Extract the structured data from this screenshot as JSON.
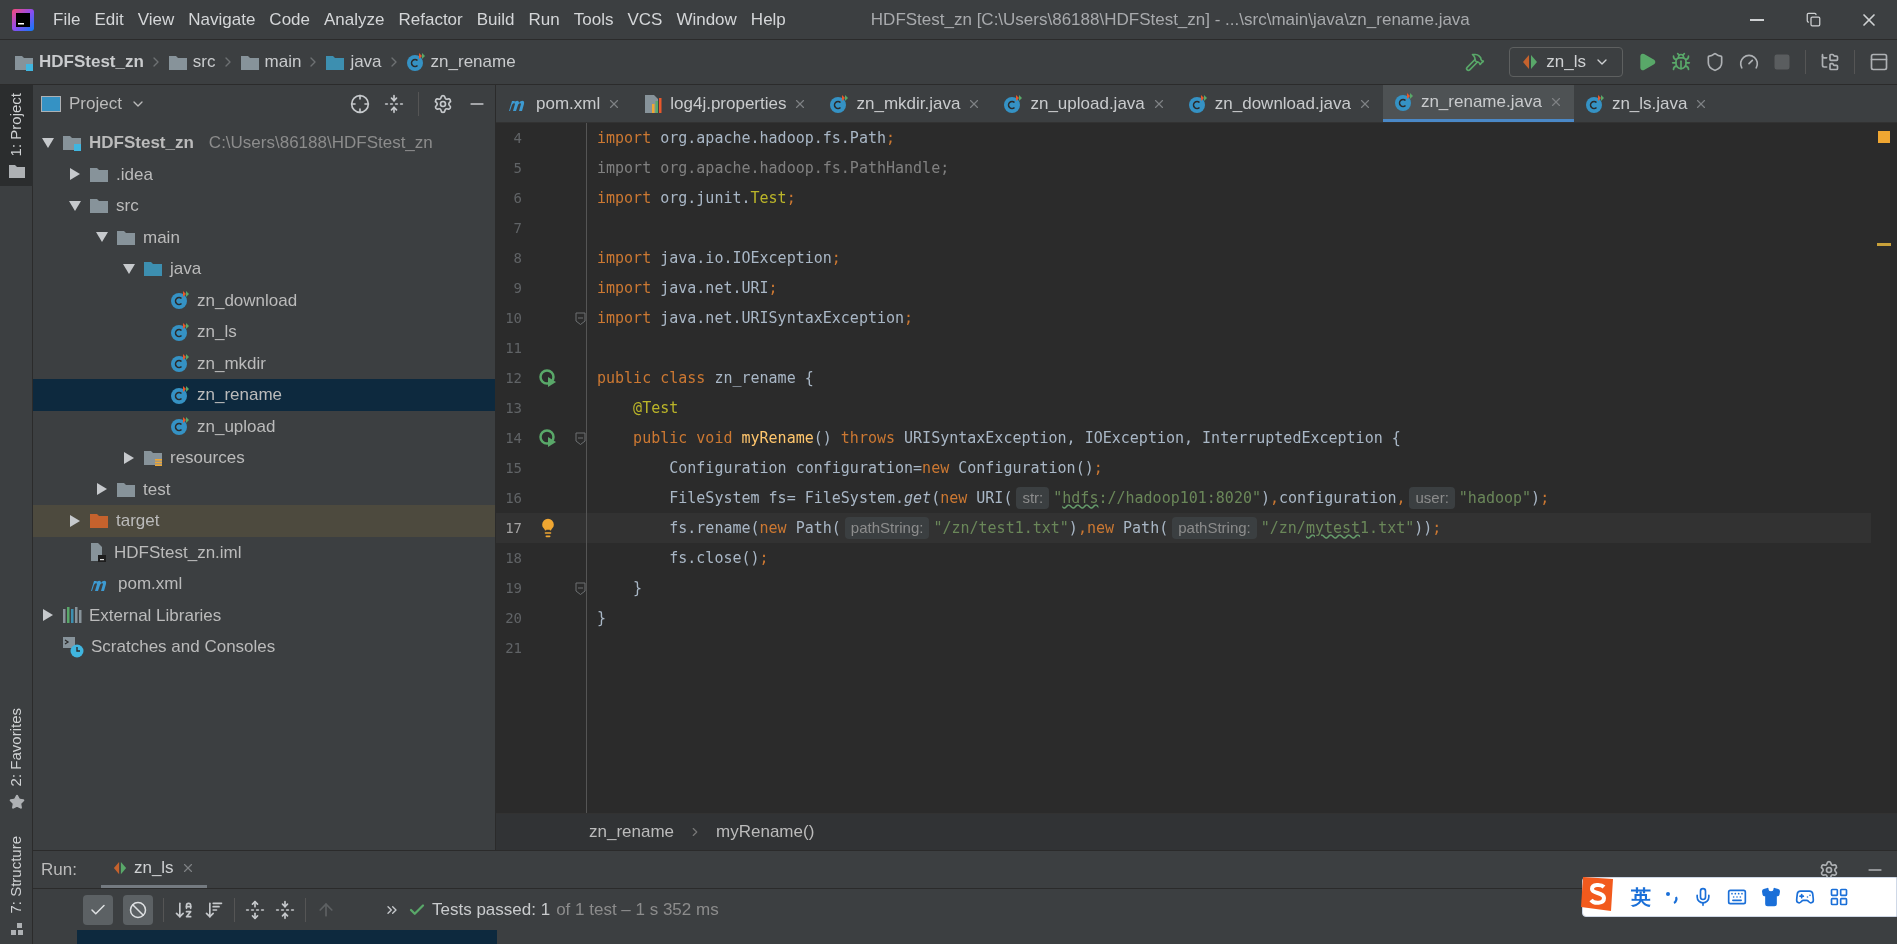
{
  "menu": [
    "File",
    "Edit",
    "View",
    "Navigate",
    "Code",
    "Analyze",
    "Refactor",
    "Build",
    "Run",
    "Tools",
    "VCS",
    "Window",
    "Help"
  ],
  "window_title": "HDFStest_zn [C:\\Users\\86188\\HDFStest_zn] - ...\\src\\main\\java\\zn_rename.java",
  "breadcrumb": [
    {
      "label": "HDFStest_zn",
      "kind": "project"
    },
    {
      "label": "src",
      "kind": "folder"
    },
    {
      "label": "main",
      "kind": "folder"
    },
    {
      "label": "java",
      "kind": "source"
    },
    {
      "label": "zn_rename",
      "kind": "class"
    }
  ],
  "run_config": "zn_ls",
  "tool_stripe": [
    {
      "label": "1: Project",
      "selected": true
    },
    {
      "label": "2: Favorites",
      "selected": false
    },
    {
      "label": "7: Structure",
      "selected": false
    }
  ],
  "project_panel": {
    "title": "Project"
  },
  "tree": [
    {
      "label": "HDFStest_zn",
      "path": "C:\\Users\\86188\\HDFStest_zn",
      "kind": "project",
      "expanded": true,
      "selected": false,
      "children": [
        {
          "label": ".idea",
          "kind": "folder",
          "expanded": false,
          "selected": false
        },
        {
          "label": "src",
          "kind": "folder",
          "expanded": true,
          "selected": false,
          "children": [
            {
              "label": "main",
              "kind": "folder",
              "expanded": true,
              "selected": false,
              "children": [
                {
                  "label": "java",
                  "kind": "source",
                  "expanded": true,
                  "selected": false,
                  "children": [
                    {
                      "label": "zn_download",
                      "kind": "class",
                      "selected": false
                    },
                    {
                      "label": "zn_ls",
                      "kind": "class",
                      "selected": false
                    },
                    {
                      "label": "zn_mkdir",
                      "kind": "class",
                      "selected": false
                    },
                    {
                      "label": "zn_rename",
                      "kind": "class",
                      "selected": true
                    },
                    {
                      "label": "zn_upload",
                      "kind": "class",
                      "selected": false
                    }
                  ]
                },
                {
                  "label": "resources",
                  "kind": "resources",
                  "expanded": false,
                  "selected": false
                }
              ]
            },
            {
              "label": "test",
              "kind": "folder",
              "expanded": false,
              "selected": false
            }
          ]
        },
        {
          "label": "target",
          "kind": "excluded",
          "expanded": false,
          "selected": false
        },
        {
          "label": "HDFStest_zn.iml",
          "kind": "iml",
          "selected": false
        },
        {
          "label": "pom.xml",
          "kind": "maven",
          "selected": false
        }
      ]
    },
    {
      "label": "External Libraries",
      "kind": "libraries",
      "expanded": false,
      "selected": false
    },
    {
      "label": "Scratches and Consoles",
      "kind": "scratches",
      "selected": false
    }
  ],
  "tabs": [
    {
      "label": "pom.xml",
      "kind": "maven",
      "selected": false
    },
    {
      "label": "log4j.properties",
      "kind": "properties",
      "selected": false
    },
    {
      "label": "zn_mkdir.java",
      "kind": "class",
      "selected": false
    },
    {
      "label": "zn_upload.java",
      "kind": "class",
      "selected": false
    },
    {
      "label": "zn_download.java",
      "kind": "class",
      "selected": false
    },
    {
      "label": "zn_rename.java",
      "kind": "class",
      "selected": true
    },
    {
      "label": "zn_ls.java",
      "kind": "class",
      "selected": false
    }
  ],
  "code_lines": [
    {
      "number": "4",
      "current": false,
      "fold": false,
      "tokens": [
        {
          "text": "import",
          "kind": "keyword"
        },
        {
          "text": " org.apache.hadoop.fs.Path",
          "kind": "plain"
        },
        {
          "text": ";",
          "kind": "keyword"
        }
      ]
    },
    {
      "number": "5",
      "current": false,
      "fold": false,
      "tokens": [
        {
          "text": "import org.apache.hadoop.fs.PathHandle;",
          "kind": "unused"
        }
      ]
    },
    {
      "number": "6",
      "current": false,
      "fold": false,
      "tokens": [
        {
          "text": "import",
          "kind": "keyword"
        },
        {
          "text": " org.junit.",
          "kind": "plain"
        },
        {
          "text": "Test",
          "kind": "annotation"
        },
        {
          "text": ";",
          "kind": "keyword"
        }
      ]
    },
    {
      "number": "7",
      "current": false,
      "fold": false
    },
    {
      "number": "8",
      "current": false,
      "fold": false,
      "tokens": [
        {
          "text": "import",
          "kind": "keyword"
        },
        {
          "text": " java.io.IOException",
          "kind": "plain"
        },
        {
          "text": ";",
          "kind": "keyword"
        }
      ]
    },
    {
      "number": "9",
      "current": false,
      "fold": false,
      "tokens": [
        {
          "text": "import",
          "kind": "keyword"
        },
        {
          "text": " java.net.URI",
          "kind": "plain"
        },
        {
          "text": ";",
          "kind": "keyword"
        }
      ]
    },
    {
      "number": "10",
      "current": false,
      "fold": true,
      "tokens": [
        {
          "text": "import",
          "kind": "keyword"
        },
        {
          "text": " java.net.URISyntaxException",
          "kind": "plain"
        },
        {
          "text": ";",
          "kind": "keyword"
        }
      ]
    },
    {
      "number": "11",
      "current": false,
      "fold": false
    },
    {
      "number": "12",
      "current": false,
      "fold": false,
      "kind": "run",
      "tokens": [
        {
          "text": "public class",
          "kind": "keyword"
        },
        {
          "text": " zn_rename {",
          "kind": "plain"
        }
      ]
    },
    {
      "number": "13",
      "current": false,
      "fold": false,
      "tokens": [
        {
          "text": "    @Test",
          "kind": "annotation"
        }
      ]
    },
    {
      "number": "14",
      "current": false,
      "fold": true,
      "kind": "run",
      "tokens": [
        {
          "text": "    public void ",
          "kind": "keyword"
        },
        {
          "text": "myRename",
          "kind": "method"
        },
        {
          "text": "() ",
          "kind": "plain"
        },
        {
          "text": "throws",
          "kind": "keyword"
        },
        {
          "text": " URISyntaxException, IOException, InterruptedException {",
          "kind": "plain"
        }
      ]
    },
    {
      "number": "15",
      "current": false,
      "fold": false,
      "tokens": [
        {
          "text": "        Configuration configuration=",
          "kind": "plain"
        },
        {
          "text": "new",
          "kind": "keyword"
        },
        {
          "text": " Configuration()",
          "kind": "plain"
        },
        {
          "text": ";",
          "kind": "keyword"
        }
      ]
    },
    {
      "number": "16",
      "current": false,
      "fold": false,
      "tokens": [
        {
          "text": "        FileSystem fs= FileSystem.",
          "kind": "plain"
        },
        {
          "text": "get",
          "kind": "static"
        },
        {
          "text": "(",
          "kind": "plain"
        },
        {
          "text": "new",
          "kind": "keyword"
        },
        {
          "text": " URI(",
          "kind": "plain"
        },
        {
          "text": "str:",
          "kind": "hint"
        },
        {
          "text": "\"",
          "kind": "string"
        },
        {
          "text": "hdfs",
          "kind": "typo"
        },
        {
          "text": "://hadoop101:8020\"",
          "kind": "string"
        },
        {
          "text": ")",
          "kind": "plain"
        },
        {
          "text": ",",
          "kind": "keyword"
        },
        {
          "text": "configuration",
          "kind": "plain"
        },
        {
          "text": ",",
          "kind": "keyword"
        },
        {
          "text": "user:",
          "kind": "hint"
        },
        {
          "text": "\"hadoop\"",
          "kind": "string"
        },
        {
          "text": ")",
          "kind": "plain"
        },
        {
          "text": ";",
          "kind": "keyword"
        }
      ]
    },
    {
      "number": "17",
      "current": true,
      "fold": false,
      "kind": "bulb",
      "tokens": [
        {
          "text": "        fs.rename(",
          "kind": "plain"
        },
        {
          "text": "new",
          "kind": "keyword"
        },
        {
          "text": " Path(",
          "kind": "plain"
        },
        {
          "text": "pathString:",
          "kind": "hint"
        },
        {
          "text": "\"/zn/test1.txt\"",
          "kind": "string"
        },
        {
          "text": ")",
          "kind": "plain"
        },
        {
          "text": ",",
          "kind": "keyword"
        },
        {
          "text": "new",
          "kind": "keyword"
        },
        {
          "text": " Path(",
          "kind": "plain"
        },
        {
          "text": "pathString:",
          "kind": "hint"
        },
        {
          "text": "\"/zn/",
          "kind": "string"
        },
        {
          "text": "mytest",
          "kind": "typo"
        },
        {
          "text": "1.txt\"",
          "kind": "string"
        },
        {
          "text": "))",
          "kind": "plain"
        },
        {
          "text": ";",
          "kind": "keyword"
        }
      ]
    },
    {
      "number": "18",
      "current": false,
      "fold": false,
      "tokens": [
        {
          "text": "        fs.close()",
          "kind": "plain"
        },
        {
          "text": ";",
          "kind": "keyword"
        }
      ]
    },
    {
      "number": "19",
      "current": false,
      "fold": true,
      "tokens": [
        {
          "text": "    }",
          "kind": "plain"
        }
      ]
    },
    {
      "number": "20",
      "current": false,
      "fold": false,
      "tokens": [
        {
          "text": "}",
          "kind": "plain"
        }
      ]
    },
    {
      "number": "21",
      "current": false,
      "fold": false
    }
  ],
  "editor_breadcrumb": [
    "zn_rename",
    "myRename()"
  ],
  "run_panel": {
    "label": "Run:",
    "tab": "zn_ls",
    "status": "Tests passed: 1",
    "detail": "of 1 test – 1 s 352 ms"
  },
  "ime": {
    "mode": "英"
  }
}
